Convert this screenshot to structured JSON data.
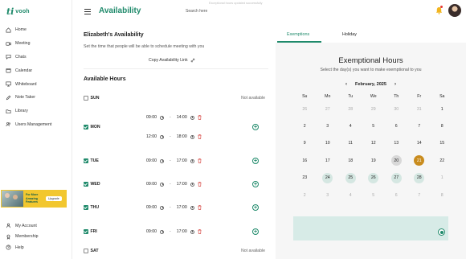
{
  "brand": {
    "logo_mark": "ti",
    "logo_text": "vooh",
    "accent": "#1f8a6b"
  },
  "sidebar": {
    "items": [
      {
        "label": "Home",
        "icon": "home-icon"
      },
      {
        "label": "Meeting",
        "icon": "video-icon"
      },
      {
        "label": "Chats",
        "icon": "chat-icon"
      },
      {
        "label": "Calendar",
        "icon": "calendar-icon"
      },
      {
        "label": "Whiteboard",
        "icon": "whiteboard-icon"
      },
      {
        "label": "Note Taker",
        "icon": "pen-icon"
      },
      {
        "label": "Library",
        "icon": "folder-icon"
      },
      {
        "label": "Users Management",
        "icon": "users-icon"
      }
    ],
    "promo": {
      "text": "For More Amazing Features",
      "button": "Upgrade"
    },
    "bottom_items": [
      {
        "label": "My Account",
        "icon": "user-icon"
      },
      {
        "label": "Membership",
        "icon": "membership-icon"
      },
      {
        "label": "Help",
        "icon": "help-icon"
      }
    ]
  },
  "header": {
    "title": "Availability",
    "search_placeholder": "Search here",
    "toast": "Exceptional hours updated successfully"
  },
  "availability": {
    "title": "Elizabeth's Availability",
    "subtitle": "Set the time that people will be able to schedule meeting with you",
    "copy_link": "Copy Availability Link",
    "hours_title": "Available Hours",
    "not_available": "Not available",
    "dash": "-",
    "days": [
      {
        "name": "SUN",
        "checked": false,
        "slots": []
      },
      {
        "name": "MON",
        "checked": true,
        "slots": [
          {
            "from": "09:00",
            "to": "14:00"
          },
          {
            "from": "12:00",
            "to": "18:00"
          }
        ]
      },
      {
        "name": "TUE",
        "checked": true,
        "slots": [
          {
            "from": "09:00",
            "to": "17:00"
          }
        ]
      },
      {
        "name": "WED",
        "checked": true,
        "slots": [
          {
            "from": "09:00",
            "to": "17:00"
          }
        ]
      },
      {
        "name": "THU",
        "checked": true,
        "slots": [
          {
            "from": "09:00",
            "to": "17:00"
          }
        ]
      },
      {
        "name": "FRI",
        "checked": true,
        "slots": [
          {
            "from": "09:00",
            "to": "17:00"
          }
        ]
      },
      {
        "name": "SAT",
        "checked": false,
        "slots": []
      }
    ]
  },
  "exemptions": {
    "tabs": [
      "Exemptions",
      "Holiday"
    ],
    "active_tab": "Exemptions",
    "title": "Exemptional Hours",
    "subtitle": "Select the day(s) you want to make exemptional to you",
    "month": "February, 2025",
    "weekdays": [
      "Su",
      "Mo",
      "Tu",
      "We",
      "Th",
      "Fr",
      "Sa"
    ],
    "weeks": [
      [
        "26",
        "27",
        "28",
        "29",
        "30",
        "31",
        "1"
      ],
      [
        "2",
        "3",
        "4",
        "5",
        "6",
        "7",
        "8"
      ],
      [
        "9",
        "10",
        "11",
        "12",
        "13",
        "14",
        "15"
      ],
      [
        "16",
        "17",
        "18",
        "19",
        "20",
        "21",
        "22"
      ],
      [
        "23",
        "24",
        "25",
        "26",
        "27",
        "28",
        "1"
      ],
      [
        "2",
        "3",
        "4",
        "5",
        "6",
        "7",
        "8"
      ]
    ],
    "muted_prefix_count": 6,
    "today": "20",
    "selected": "21",
    "exempt_days": [
      "24",
      "25",
      "26",
      "27",
      "28"
    ],
    "colors": {
      "selected": "#c98c1e",
      "exempt": "#d5e7e2",
      "save_bar": "#d7ebe7"
    }
  }
}
